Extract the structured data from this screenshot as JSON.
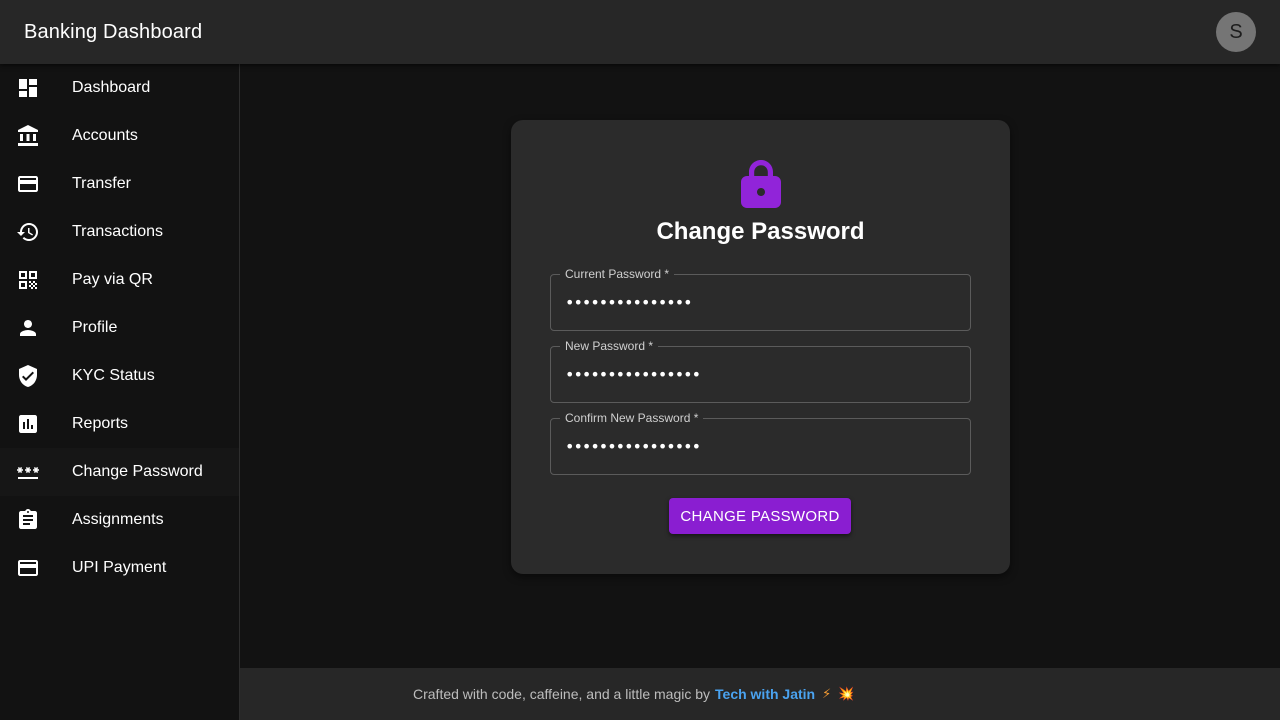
{
  "app": {
    "title": "Banking Dashboard",
    "avatar_letter": "S"
  },
  "sidebar": {
    "items": [
      {
        "label": "Dashboard",
        "icon": "dashboard-icon",
        "active": false
      },
      {
        "label": "Accounts",
        "icon": "bank-icon",
        "active": false
      },
      {
        "label": "Transfer",
        "icon": "credit-card-icon",
        "active": false
      },
      {
        "label": "Transactions",
        "icon": "history-icon",
        "active": false
      },
      {
        "label": "Pay via QR",
        "icon": "qr-code-icon",
        "active": false
      },
      {
        "label": "Profile",
        "icon": "person-icon",
        "active": false
      },
      {
        "label": "KYC Status",
        "icon": "verified-shield-icon",
        "active": false
      },
      {
        "label": "Reports",
        "icon": "bar-chart-icon",
        "active": false
      },
      {
        "label": "Change Password",
        "icon": "password-icon",
        "active": true
      },
      {
        "label": "Assignments",
        "icon": "clipboard-icon",
        "active": false
      },
      {
        "label": "UPI Payment",
        "icon": "credit-card-icon",
        "active": false
      }
    ]
  },
  "form": {
    "title": "Change Password",
    "icon": "lock-icon",
    "fields": [
      {
        "label": "Current Password *",
        "value": "•••••••••••••••"
      },
      {
        "label": "New Password *",
        "value": "••••••••••••••••"
      },
      {
        "label": "Confirm New Password *",
        "value": "••••••••••••••••"
      }
    ],
    "submit_label": "Change Password"
  },
  "footer": {
    "text": "Crafted with code, caffeine, and a little magic by",
    "link": "Tech with Jatin",
    "emoji_1": "⚡",
    "emoji_2": "💥"
  },
  "colors": {
    "accent": "#8a1ed1",
    "lock": "#9124d9",
    "link": "#4aa3f0",
    "background": "#121212",
    "surface": "#2b2b2b",
    "appbar": "#272727"
  }
}
